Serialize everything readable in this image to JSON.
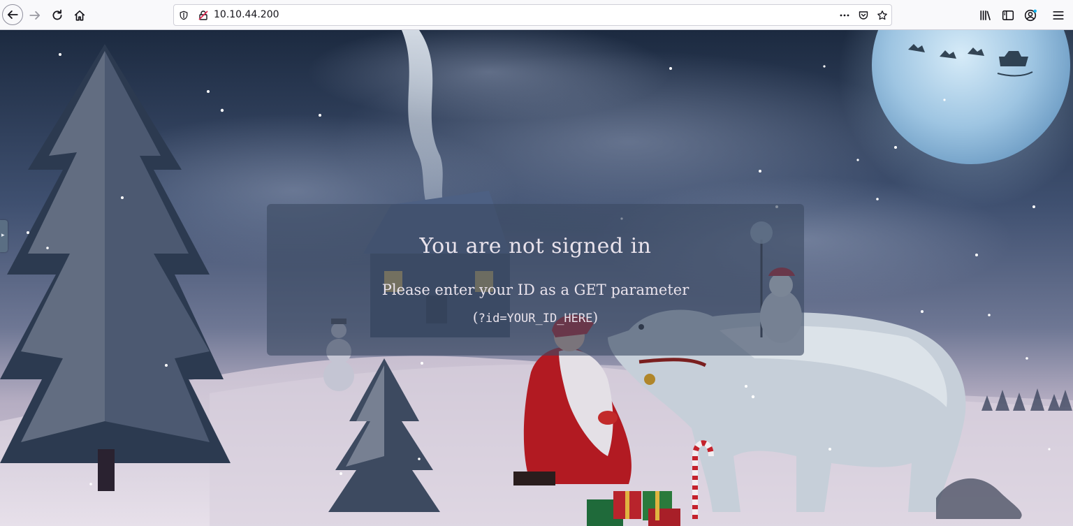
{
  "browser": {
    "url": "10.10.44.200",
    "icons": {
      "back": "back-arrow-icon",
      "forward": "forward-arrow-icon",
      "reload": "reload-icon",
      "home": "home-icon",
      "shield": "tracking-protection-shield-icon",
      "insecure": "insecure-connection-icon",
      "page_actions": "more-actions-icon",
      "pocket": "pocket-icon",
      "bookmark": "bookmark-star-icon",
      "library": "library-icon",
      "sidebar": "sidebar-icon",
      "account": "account-icon",
      "menu": "hamburger-menu-icon"
    }
  },
  "page": {
    "title": "You are not signed in",
    "subtitle": "Please enter your ID as a GET parameter",
    "hint_open": "(",
    "hint_code": "?id=YOUR_ID_HERE",
    "hint_close": ")"
  },
  "colors": {
    "sky_top": "#1c2a40",
    "sky_mid": "#4c5d79",
    "snow": "#d7cedb",
    "moon": "#a9cbe6",
    "panel": "#3c4a62",
    "panel_text": "#e9e3ec"
  }
}
